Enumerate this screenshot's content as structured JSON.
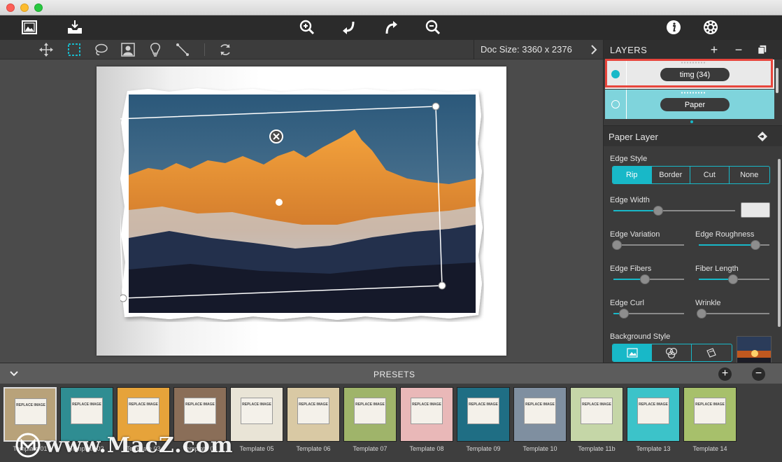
{
  "toolbar": {
    "icons": [
      "image-browser-icon",
      "export-icon",
      "zoom-in-icon",
      "undo-icon",
      "redo-icon",
      "zoom-out-icon",
      "info-icon",
      "settings-icon"
    ]
  },
  "tools": {
    "icons": [
      "move-icon",
      "rect-select-icon",
      "lasso-icon",
      "portrait-icon",
      "light-icon",
      "line-icon",
      "rotate-icon"
    ],
    "doc_size": "Doc Size: 3360 x 2376"
  },
  "layers": {
    "title": "LAYERS",
    "items": [
      {
        "name": "timg (34)",
        "selected": true
      },
      {
        "name": "Paper",
        "selected": false
      }
    ]
  },
  "paper_layer": {
    "title": "Paper Layer",
    "edge_style_label": "Edge Style",
    "edge_styles": [
      "Rip",
      "Border",
      "Cut",
      "None"
    ],
    "edge_style_selected": "Rip",
    "edge_width": {
      "label": "Edge Width",
      "value": 0.37
    },
    "edge_variation": {
      "label": "Edge Variation",
      "value": 0.05
    },
    "edge_roughness": {
      "label": "Edge Roughness",
      "value": 0.8
    },
    "edge_fibers": {
      "label": "Edge Fibers",
      "value": 0.45
    },
    "fiber_length": {
      "label": "Fiber Length",
      "value": 0.49
    },
    "edge_curl": {
      "label": "Edge Curl",
      "value": 0.15
    },
    "wrinkle": {
      "label": "Wrinkle",
      "value": 0.04
    },
    "background_style_label": "Background Style",
    "colors": {
      "accent": "#18b8c8",
      "swatch": "#e8e8e8"
    }
  },
  "presets": {
    "title": "PRESETS",
    "templates": [
      {
        "label": "Template 01",
        "bg": "#b8a27a",
        "caption": "REPLACE IMAGE"
      },
      {
        "label": "Template 02",
        "bg": "#2f8d92",
        "caption": "REPLACE IMAGE"
      },
      {
        "label": "Template 03",
        "bg": "#e6a33a",
        "caption": "REPLACE IMAGE"
      },
      {
        "label": "Template 04",
        "bg": "#8a6e58",
        "caption": "REPLACE IMAGE"
      },
      {
        "label": "Template 05",
        "bg": "#e9e4d6",
        "caption": "REPLACE IMAGE"
      },
      {
        "label": "Template 06",
        "bg": "#d9c9a4",
        "caption": "REPLACE IMAGE"
      },
      {
        "label": "Template 07",
        "bg": "#9fb46a",
        "caption": "REPLACE IMAGE"
      },
      {
        "label": "Template 08",
        "bg": "#e9b8b8",
        "caption": "REPLACE IMAGE"
      },
      {
        "label": "Template 09",
        "bg": "#1f6e84",
        "caption": "REPLACE IMAGE"
      },
      {
        "label": "Template 10",
        "bg": "#7f8fa0",
        "caption": "REPLACE IMAGE"
      },
      {
        "label": "Template 11b",
        "bg": "#c5d6a7",
        "caption": "REPLACE IMAGE"
      },
      {
        "label": "Template 13",
        "bg": "#3cc3c9",
        "caption": "REPLACE IMAGE"
      },
      {
        "label": "Template 14",
        "bg": "#a7c06b",
        "caption": "REPLACE IMAGE"
      }
    ]
  },
  "watermark": {
    "text": "www.MacZ.com"
  }
}
